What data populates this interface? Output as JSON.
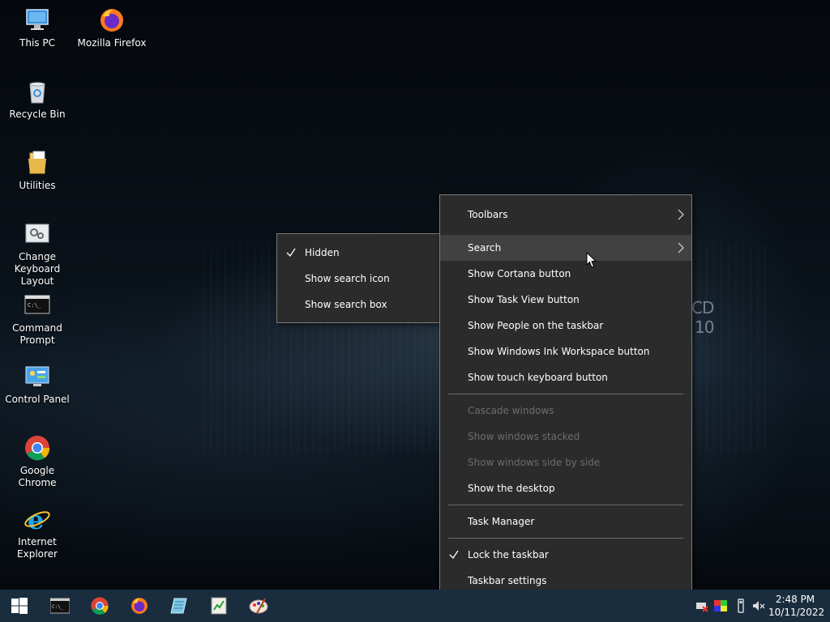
{
  "desktop": {
    "icons": [
      {
        "label": "This PC",
        "icon": "computer-icon"
      },
      {
        "label": "Mozilla Firefox",
        "icon": "firefox-icon"
      },
      {
        "label": "Recycle Bin",
        "icon": "recycle-bin-icon"
      },
      {
        "label": "Utilities",
        "icon": "folder-icon"
      },
      {
        "label": "Change Keyboard Layout",
        "icon": "keyboard-settings-icon"
      },
      {
        "label": "Command Prompt",
        "icon": "command-prompt-icon"
      },
      {
        "label": "Control Panel",
        "icon": "control-panel-icon"
      },
      {
        "label": "Google Chrome",
        "icon": "chrome-icon"
      },
      {
        "label": "Internet Explorer",
        "icon": "internet-explorer-icon"
      }
    ],
    "wallpaper_text": [
      "CD",
      "10"
    ]
  },
  "submenu": {
    "items": [
      {
        "label": "Hidden",
        "checked": true
      },
      {
        "label": "Show search icon",
        "checked": false
      },
      {
        "label": "Show search box",
        "checked": false
      }
    ]
  },
  "context_menu": {
    "items": [
      {
        "label": "Toolbars",
        "has_submenu": true
      },
      {
        "label": "Search",
        "has_submenu": true,
        "highlighted": true
      },
      {
        "label": "Show Cortana button"
      },
      {
        "label": "Show Task View button"
      },
      {
        "label": "Show People on the taskbar"
      },
      {
        "label": "Show Windows Ink Workspace button"
      },
      {
        "label": "Show touch keyboard button"
      },
      {
        "label": "Cascade windows",
        "disabled": true
      },
      {
        "label": "Show windows stacked",
        "disabled": true
      },
      {
        "label": "Show windows side by side",
        "disabled": true
      },
      {
        "label": "Show the desktop"
      },
      {
        "label": "Task Manager"
      },
      {
        "label": "Lock the taskbar",
        "checked": true
      },
      {
        "label": "Taskbar settings"
      }
    ]
  },
  "taskbar": {
    "pinned": [
      "start-icon",
      "command-prompt-icon",
      "chrome-icon",
      "firefox-icon",
      "notepad-icon",
      "spreadsheet-icon",
      "paint-icon"
    ],
    "tray": [
      "network-icon",
      "color-icon",
      "usb-icon",
      "volume-muted-icon"
    ],
    "clock": {
      "time": "2:48 PM",
      "date": "10/11/2022"
    },
    "color": "#1a2d3f"
  }
}
